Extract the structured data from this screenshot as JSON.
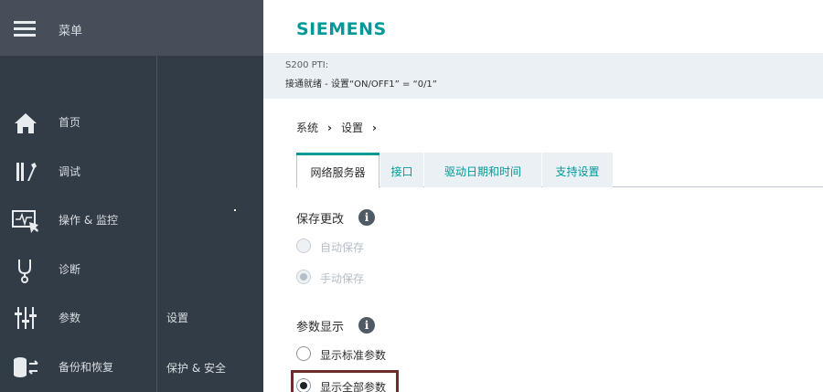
{
  "sidebar": {
    "menu_label": "菜单",
    "items": [
      {
        "label": "首页",
        "icon": "home-icon"
      },
      {
        "label": "调试",
        "icon": "tools-icon"
      },
      {
        "label": "操作 & 监控",
        "icon": "monitor-icon"
      },
      {
        "label": "诊断",
        "icon": "stethoscope-icon"
      },
      {
        "label": "参数",
        "icon": "sliders-icon"
      },
      {
        "label": "备份和恢复",
        "icon": "backup-restore-icon"
      }
    ],
    "sub_items": [
      {
        "label": "设置"
      },
      {
        "label": "保护 & 安全"
      }
    ]
  },
  "header": {
    "brand": "SIEMENS"
  },
  "status": {
    "device": "S200 PTI:",
    "message": "接通就绪 - 设置“ON/OFF1” = “0/1”"
  },
  "breadcrumb": {
    "items": [
      "系统",
      "设置"
    ],
    "separator": "›"
  },
  "tabs": [
    {
      "label": "网络服务器",
      "active": true
    },
    {
      "label": "接口",
      "active": false
    },
    {
      "label": "驱动日期和时间",
      "active": false
    },
    {
      "label": "支持设置",
      "active": false
    }
  ],
  "save_section": {
    "title": "保存更改",
    "options": [
      {
        "label": "自动保存",
        "selected": false,
        "disabled": true
      },
      {
        "label": "手动保存",
        "selected": true,
        "disabled": true
      }
    ]
  },
  "param_section": {
    "title": "参数显示",
    "options": [
      {
        "label": "显示标准参数",
        "selected": false
      },
      {
        "label": "显示全部参数",
        "selected": true
      }
    ]
  },
  "colors": {
    "brand": "#009999",
    "sidebar_bg": "#323c46",
    "highlight_border": "#6e2d28"
  }
}
